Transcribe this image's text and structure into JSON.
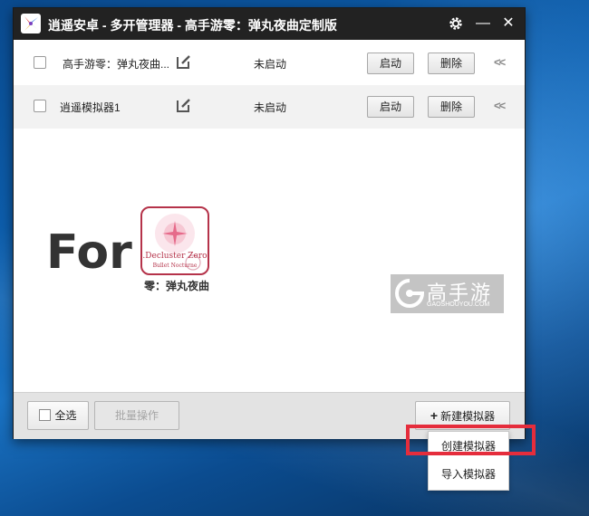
{
  "window": {
    "title": "逍遥安卓 - 多开管理器 - 高手游零：弹丸夜曲定制版"
  },
  "titlebar": {
    "settings_icon": "gear-icon",
    "minimize_glyph": "—",
    "close_glyph": "✕"
  },
  "emulators": [
    {
      "name": "高手游零：弹丸夜曲...",
      "status": "未启动",
      "start_label": "启动",
      "delete_label": "删除",
      "collapse_glyph": "<<"
    },
    {
      "name": "逍遥模拟器1",
      "status": "未启动",
      "start_label": "启动",
      "delete_label": "删除",
      "collapse_glyph": "<<"
    }
  ],
  "promo": {
    "for_text": "For",
    "game_icon_text": ".Decluster Zero",
    "game_icon_subtext": "Bullet Nocturne",
    "game_caption": "零：弹丸夜曲",
    "site_name": "高手游",
    "site_domain": "GAOSHOUYOU.COM"
  },
  "footer": {
    "select_all_label": "全选",
    "batch_label": "批量操作",
    "new_emulator_label": "新建模拟器",
    "new_emulator_icon": "plus-icon"
  },
  "dropdown": {
    "items": [
      "创建模拟器",
      "导入模拟器"
    ]
  },
  "colors": {
    "titlebar": "#222222",
    "highlight": "#e52d3c",
    "game_icon_border": "#b5334a"
  }
}
